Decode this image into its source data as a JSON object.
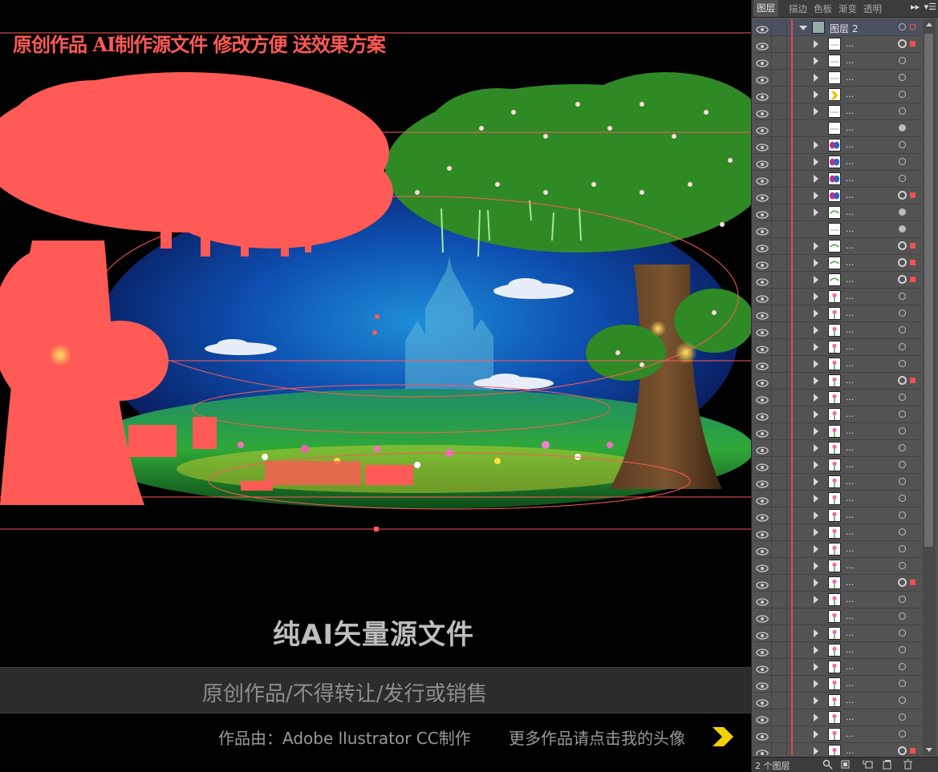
{
  "canvas": {
    "overlay_title": "原创作品 AI制作源文件 修改方便 送效果方案",
    "main_title": "纯AI矢量源文件",
    "notice": "原创作品/不得转让/发行或销售",
    "credit": "作品由：Adobe llustrator CC制作",
    "more": "更多作品请点击我的头像",
    "selection_color": "#ff5a55"
  },
  "panel": {
    "tabs": [
      "图层",
      "描边",
      "色板",
      "渐变",
      "透明"
    ],
    "active_tab": "图层",
    "top_layer_name": "图层 2",
    "sublayer_name": "...",
    "footer_count": "2 个图层",
    "layer_color": "#e04848"
  }
}
